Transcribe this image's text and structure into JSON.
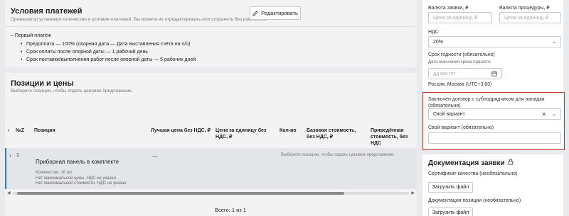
{
  "conditions": {
    "title": "Условия платежей",
    "subtitle": "Организатор установил количество и условия платежей. Вы можете их отредактировать или сохранить без изменений.",
    "edit_button": "Редактировать",
    "payment_head": "– Первый платёж",
    "payment_items": [
      "Предоплата — 100% (опорная дата — Дата выставления счёта на п/о)",
      "Срок оплаты после опорной даты — 1 рабочий день",
      "Срок поставки/выполнения работ после опорной даты — 5 рабочих дней"
    ]
  },
  "positions": {
    "title": "Позиции и цены",
    "subtitle": "Выберите позиции, чтобы подать ценовое предложение.",
    "columns": [
      "№Z",
      "Позиция",
      "Лучшая цена без НДС, ₽",
      "Цена за единицу без НДС, ₽",
      "Кол-во",
      "Базовая стоимость, без НДС, ₽",
      "Приведённая стоимость, без НДС"
    ],
    "row": {
      "num": "1",
      "name": "Приборная панель в комплекте",
      "quantity": "Количество: 10 шт",
      "max_price": "Нет максимальной цены, НДС не указан",
      "max_cost": "Нет максимальной стоимости, НДС не указан",
      "best_price": "—",
      "hint": "Выберите позицию, чтобы подать ценовое предложение."
    },
    "pager": "Всего: 1 из 1"
  },
  "form": {
    "app_currency_label": "Валюта заявки, ₽",
    "proc_currency_label": "Валюта процедуры, ₽",
    "unit_price_placeholder": "Цена за единицу, ₽",
    "vat_label": "НДС",
    "vat_value": "20%",
    "expiry_label": "Срок годности (обязательно)",
    "expiry_small": "Дата окончания срока годности",
    "date_placeholder": "дд.мм.гггг",
    "timezone": "Россия, Москва (UTC+3:00)",
    "contract_label": "Заключен договор с субподрядчиком для наладки (обязательно)",
    "contract_value": "Свой вариант",
    "own_label": "Свой вариант (обязательно)",
    "own_value": ""
  },
  "docs": {
    "title": "Документация заявки",
    "quality_label": "Сертификат качества (необязательно)",
    "upload1": "Загрузить файл",
    "pos_doc_label": "Документация позиции (необязательно)",
    "upload2": "Загрузить файл"
  }
}
